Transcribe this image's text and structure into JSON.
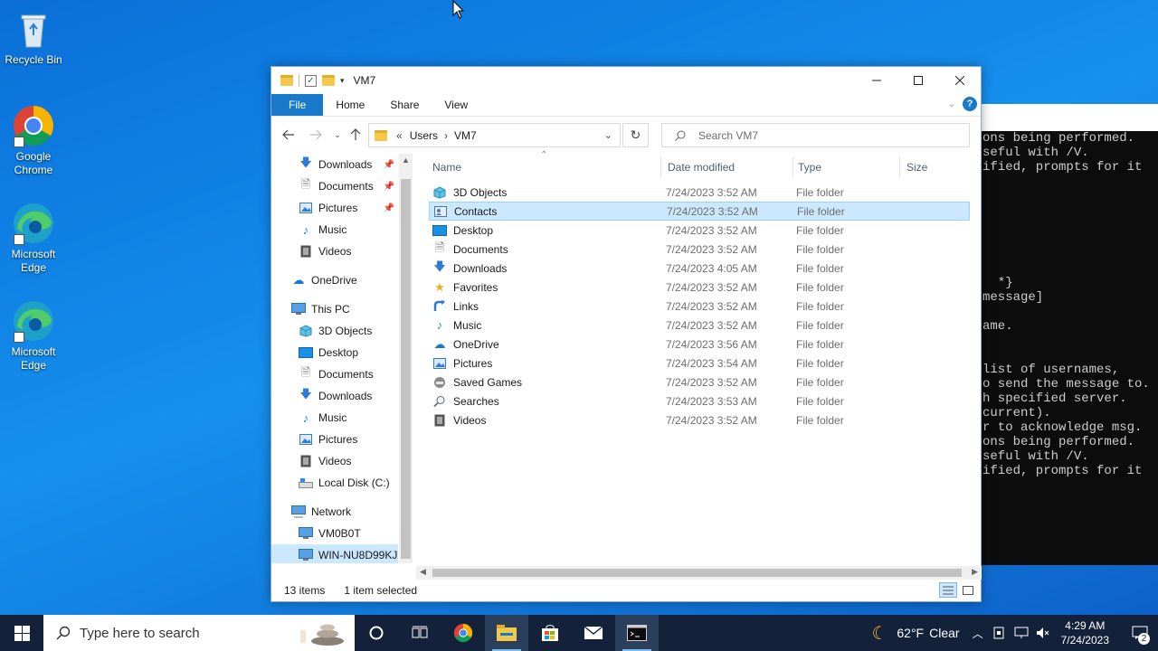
{
  "desktop": {
    "icons": [
      {
        "label": "Recycle Bin",
        "icon": "recycle-bin-icon"
      },
      {
        "label": "Google Chrome",
        "icon": "chrome-icon"
      },
      {
        "label": "Microsoft Edge",
        "icon": "edge-icon"
      },
      {
        "label": "Microsoft Edge",
        "icon": "edge-icon"
      }
    ]
  },
  "console": {
    "lines": [
      "ons being performed.",
      "seful with /V.",
      "ified, prompts for it",
      "  *}",
      "message]",
      "ame.",
      "list of usernames,",
      "o send the message to.",
      "h specified server.",
      "current).",
      "r to acknowledge msg.",
      "ons being performed.",
      "seful with /V.",
      "ified, prompts for it"
    ]
  },
  "explorer": {
    "title": "VM7",
    "ribbon_tabs": [
      "File",
      "Home",
      "Share",
      "View"
    ],
    "breadcrumb": [
      "Users",
      "VM7"
    ],
    "breadcrumb_overflow": "«",
    "search_placeholder": "Search VM7",
    "nav_pane": {
      "quick_access": [
        {
          "label": "Downloads",
          "icon": "download-arrow-icon",
          "pinned": true
        },
        {
          "label": "Documents",
          "icon": "document-icon",
          "pinned": true
        },
        {
          "label": "Pictures",
          "icon": "pictures-icon",
          "pinned": true
        },
        {
          "label": "Music",
          "icon": "music-icon"
        },
        {
          "label": "Videos",
          "icon": "videos-icon"
        }
      ],
      "onedrive": "OneDrive",
      "this_pc": "This PC",
      "this_pc_items": [
        {
          "label": "3D Objects",
          "icon": "3d-objects-icon"
        },
        {
          "label": "Desktop",
          "icon": "desktop-folder-icon"
        },
        {
          "label": "Documents",
          "icon": "document-icon"
        },
        {
          "label": "Downloads",
          "icon": "download-arrow-icon"
        },
        {
          "label": "Music",
          "icon": "music-icon"
        },
        {
          "label": "Pictures",
          "icon": "pictures-icon"
        },
        {
          "label": "Videos",
          "icon": "videos-icon"
        },
        {
          "label": "Local Disk (C:)",
          "icon": "local-disk-icon"
        }
      ],
      "network": "Network",
      "network_items": [
        {
          "label": "VM0B0T",
          "icon": "computer-icon"
        },
        {
          "label": "WIN-NU8D99KJ",
          "icon": "computer-icon"
        }
      ]
    },
    "columns": {
      "name": "Name",
      "date": "Date modified",
      "type": "Type",
      "size": "Size"
    },
    "files": [
      {
        "name": "3D Objects",
        "date": "7/24/2023 3:52 AM",
        "type": "File folder",
        "icon": "3d-objects-icon"
      },
      {
        "name": "Contacts",
        "date": "7/24/2023 3:52 AM",
        "type": "File folder",
        "icon": "contacts-icon",
        "selected": true
      },
      {
        "name": "Desktop",
        "date": "7/24/2023 3:52 AM",
        "type": "File folder",
        "icon": "desktop-folder-icon"
      },
      {
        "name": "Documents",
        "date": "7/24/2023 3:52 AM",
        "type": "File folder",
        "icon": "document-icon"
      },
      {
        "name": "Downloads",
        "date": "7/24/2023 4:05 AM",
        "type": "File folder",
        "icon": "download-arrow-icon"
      },
      {
        "name": "Favorites",
        "date": "7/24/2023 3:52 AM",
        "type": "File folder",
        "icon": "favorites-star-icon"
      },
      {
        "name": "Links",
        "date": "7/24/2023 3:52 AM",
        "type": "File folder",
        "icon": "links-icon"
      },
      {
        "name": "Music",
        "date": "7/24/2023 3:52 AM",
        "type": "File folder",
        "icon": "music-icon"
      },
      {
        "name": "OneDrive",
        "date": "7/24/2023 3:56 AM",
        "type": "File folder",
        "icon": "onedrive-cloud-icon"
      },
      {
        "name": "Pictures",
        "date": "7/24/2023 3:54 AM",
        "type": "File folder",
        "icon": "pictures-icon"
      },
      {
        "name": "Saved Games",
        "date": "7/24/2023 3:52 AM",
        "type": "File folder",
        "icon": "saved-games-icon"
      },
      {
        "name": "Searches",
        "date": "7/24/2023 3:53 AM",
        "type": "File folder",
        "icon": "searches-icon"
      },
      {
        "name": "Videos",
        "date": "7/24/2023 3:52 AM",
        "type": "File folder",
        "icon": "videos-icon"
      }
    ],
    "status": {
      "item_count": "13 items",
      "selection": "1 item selected"
    }
  },
  "taskbar": {
    "search_placeholder": "Type here to search",
    "weather": {
      "temp": "62°F",
      "condition": "Clear"
    },
    "clock": {
      "time": "4:29 AM",
      "date": "7/24/2023"
    },
    "notification_count": "2"
  },
  "colors": {
    "accent": "#1979ca",
    "selection": "#cce8ff",
    "taskbar": "#13223a"
  }
}
